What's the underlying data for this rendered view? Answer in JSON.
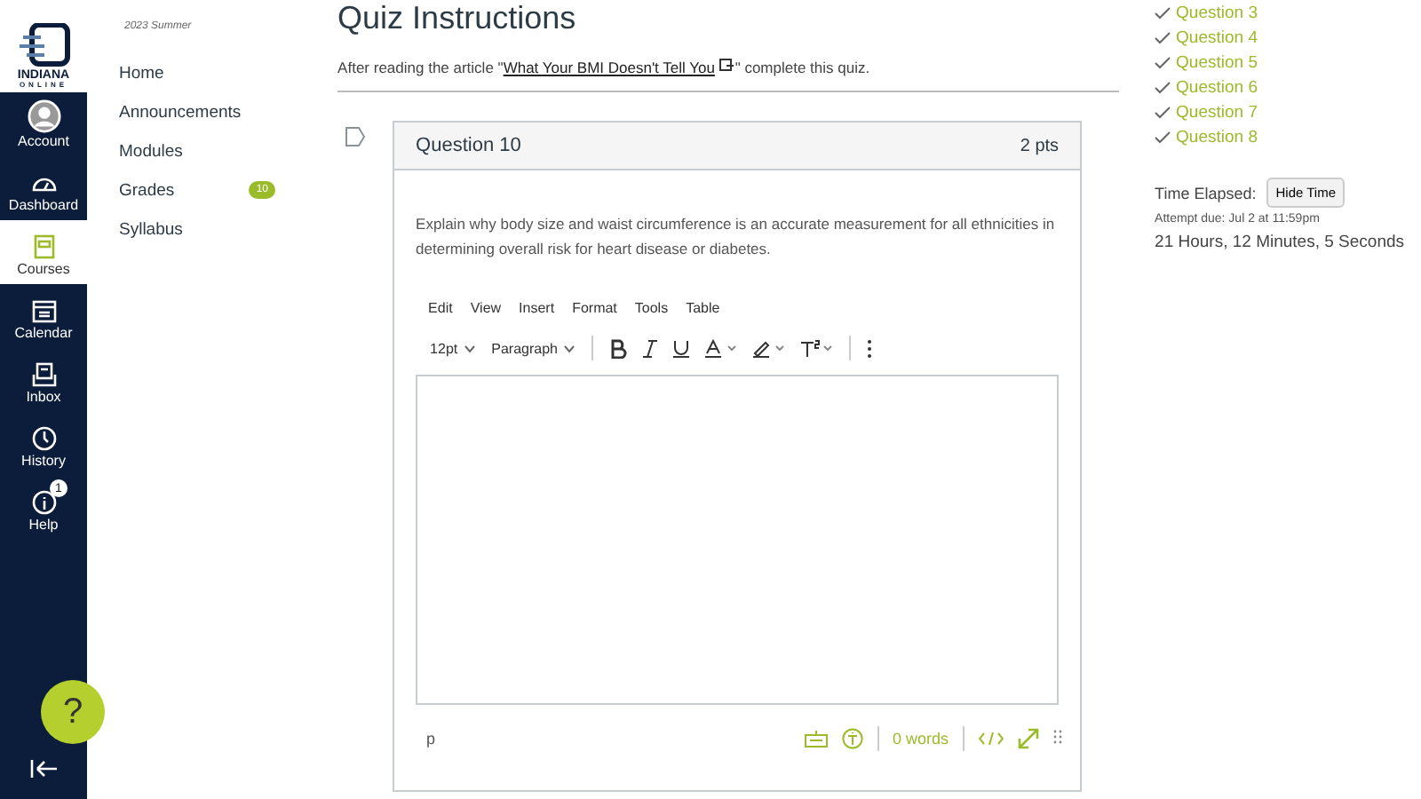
{
  "logo": {
    "line1": "INDIANA",
    "line2": "ONLINE"
  },
  "global_nav": [
    {
      "label": "Account",
      "selected": false
    },
    {
      "label": "Dashboard",
      "selected": false
    },
    {
      "label": "Courses",
      "selected": true
    },
    {
      "label": "Calendar",
      "selected": false
    },
    {
      "label": "Inbox",
      "selected": false
    },
    {
      "label": "History",
      "selected": false
    },
    {
      "label": "Help",
      "selected": false,
      "badge": "1"
    }
  ],
  "help_button": "?",
  "term": "2023 Summer",
  "course_nav": [
    {
      "label": "Home"
    },
    {
      "label": "Announcements"
    },
    {
      "label": "Modules"
    },
    {
      "label": "Grades",
      "badge": "10"
    },
    {
      "label": "Syllabus"
    }
  ],
  "page_title": "Quiz Instructions",
  "instructions": {
    "before": "After reading the article \"",
    "link": "What Your BMI Doesn't Tell You",
    "after": "\" complete this quiz."
  },
  "question": {
    "title": "Question 10",
    "points": "2 pts",
    "text": "Explain why body size and waist circumference is an accurate measurement for all ethnicities in determining overall risk for heart disease or diabetes.",
    "flagged": false
  },
  "editor": {
    "menu": [
      "Edit",
      "View",
      "Insert",
      "Format",
      "Tools",
      "Table"
    ],
    "font_size": "12pt",
    "block": "Paragraph",
    "path": "p",
    "word_count": "0 words"
  },
  "question_list": [
    {
      "label": "Question 3",
      "answered": true
    },
    {
      "label": "Question 4",
      "answered": true
    },
    {
      "label": "Question 5",
      "answered": true
    },
    {
      "label": "Question 6",
      "answered": true
    },
    {
      "label": "Question 7",
      "answered": true
    },
    {
      "label": "Question 8",
      "answered": true
    }
  ],
  "timer": {
    "label": "Time Elapsed:",
    "button": "Hide Time",
    "due": "Attempt due: Jul 2 at 11:59pm",
    "elapsed": "21 Hours, 12 Minutes, 5 Seconds"
  }
}
